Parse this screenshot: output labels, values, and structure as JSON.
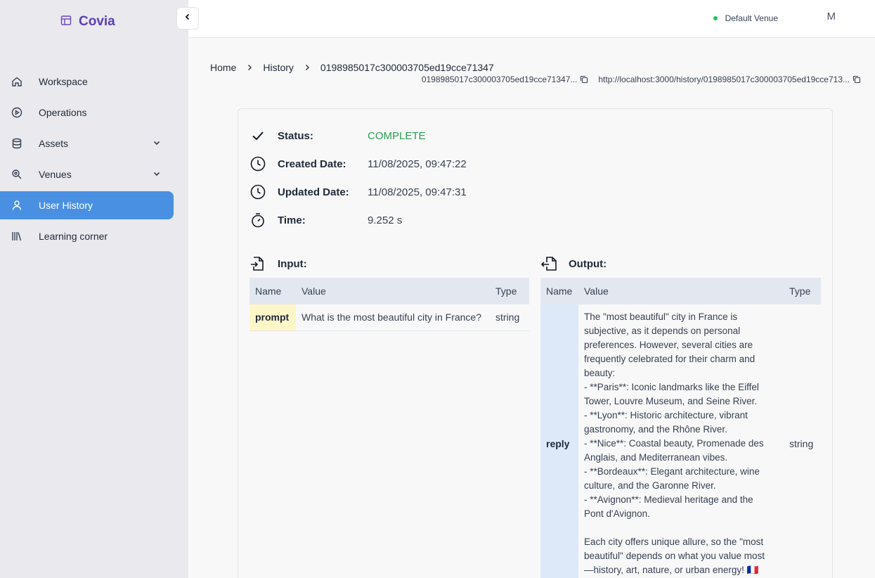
{
  "brand": {
    "name": "Covia"
  },
  "sidebar": {
    "items": [
      {
        "label": "Workspace",
        "icon": "home-icon",
        "expandable": false,
        "active": false
      },
      {
        "label": "Operations",
        "icon": "play-circle-icon",
        "expandable": false,
        "active": false
      },
      {
        "label": "Assets",
        "icon": "database-icon",
        "expandable": true,
        "active": false
      },
      {
        "label": "Venues",
        "icon": "map-pin-icon",
        "expandable": true,
        "active": false
      },
      {
        "label": "User History",
        "icon": "user-icon",
        "expandable": false,
        "active": true
      },
      {
        "label": "Learning corner",
        "icon": "library-icon",
        "expandable": false,
        "active": false
      }
    ]
  },
  "header": {
    "venue": "Default Venue",
    "avatar": "M"
  },
  "breadcrumb": {
    "home": "Home",
    "history": "History",
    "current": "0198985017c300003705ed19cce71347"
  },
  "copy": {
    "id": "0198985017c300003705ed19cce71347...",
    "url": "http://localhost:3000/history/0198985017c300003705ed19cce713..."
  },
  "details": {
    "status_label": "Status:",
    "status_value": "COMPLETE",
    "created_label": "Created Date:",
    "created_value": "11/08/2025, 09:47:22",
    "updated_label": "Updated Date:",
    "updated_value": "11/08/2025, 09:47:31",
    "time_label": "Time:",
    "time_value": "9.252 s"
  },
  "input": {
    "title": "Input:",
    "headers": [
      "Name",
      "Value",
      "Type"
    ],
    "rows": [
      {
        "name": "prompt",
        "value": "What is the most beautiful city in France?",
        "type": "string"
      }
    ]
  },
  "output": {
    "title": "Output:",
    "headers": [
      "Name",
      "Value",
      "Type"
    ],
    "rows": [
      {
        "name": "reply",
        "value": "The \"most beautiful\" city in France is\nsubjective, as it depends on personal\npreferences. However, several cities are\nfrequently celebrated for their charm and\nbeauty:\n- **Paris**: Iconic landmarks like the Eiffel\nTower, Louvre Museum, and Seine River.\n- **Lyon**: Historic architecture, vibrant\ngastronomy, and the Rhône River.\n- **Nice**: Coastal beauty, Promenade des\nAnglais, and Mediterranean vibes.\n- **Bordeaux**: Elegant architecture, wine\nculture, and the Garonne River.\n- **Avignon**: Medieval heritage and the\nPont d'Avignon.\n\nEach city offers unique allure, so the \"most\nbeautiful\" depends on what you value most\n—history, art, nature, or urban energy! 🇫🇷",
        "type": "string"
      }
    ]
  },
  "colors": {
    "accent": "#4a90e2",
    "brand": "#5b3fb3",
    "status_ok": "#2a9d55"
  }
}
